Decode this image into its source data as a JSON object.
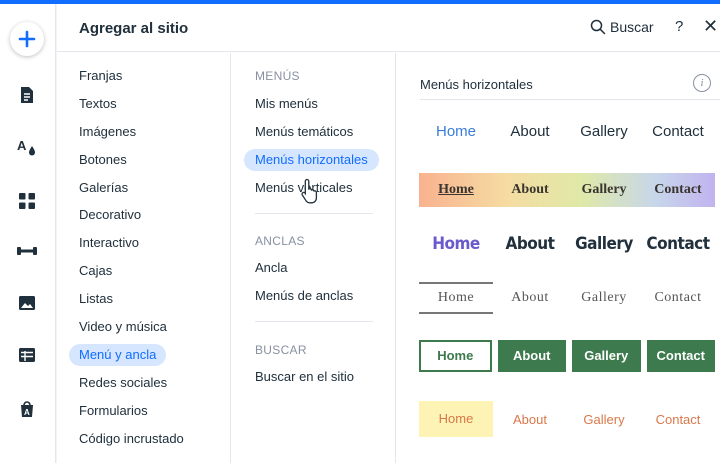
{
  "header": {
    "title": "Agregar al sitio",
    "search_label": "Buscar",
    "help_label": "?",
    "close_label": "✕"
  },
  "rail": {
    "icons": [
      "plus-icon",
      "page-icon",
      "text-style-icon",
      "apps-icon",
      "fitness-icon",
      "media-icon",
      "table-icon",
      "app-market-icon"
    ]
  },
  "categories": [
    "Franjas",
    "Textos",
    "Imágenes",
    "Botones",
    "Galerías",
    "Decorativo",
    "Interactivo",
    "Cajas",
    "Listas",
    "Video y música",
    "Menú y ancla",
    "Redes sociales",
    "Formularios",
    "Código incrustado"
  ],
  "selected_category": "Menú y ancla",
  "subsections": {
    "menus": {
      "title": "MENÚS",
      "items": [
        "Mis menús",
        "Menús temáticos",
        "Menús horizontales",
        "Menús verticales"
      ]
    },
    "anclas": {
      "title": "ANCLAS",
      "items": [
        "Ancla",
        "Menús de anclas"
      ]
    },
    "buscar": {
      "title": "BUSCAR",
      "items": [
        "Buscar en el sitio"
      ]
    }
  },
  "selected_subsection": "Menús horizontales",
  "preview": {
    "title": "Menús horizontales",
    "info_label": "i",
    "menus": [
      [
        "Home",
        "About",
        "Gallery",
        "Contact"
      ],
      [
        "Home",
        "About",
        "Gallery",
        "Contact"
      ],
      [
        "Home",
        "About",
        "Gallery",
        "Contact"
      ],
      [
        "Home",
        "About",
        "Gallery",
        "Contact"
      ],
      [
        "Home",
        "About",
        "Gallery",
        "Contact"
      ],
      [
        "Home",
        "About",
        "Gallery",
        "Contact"
      ]
    ]
  },
  "colors": {
    "accent": "#116dff",
    "selected_bg": "#d6e6fe",
    "green": "#3d7a4d"
  }
}
